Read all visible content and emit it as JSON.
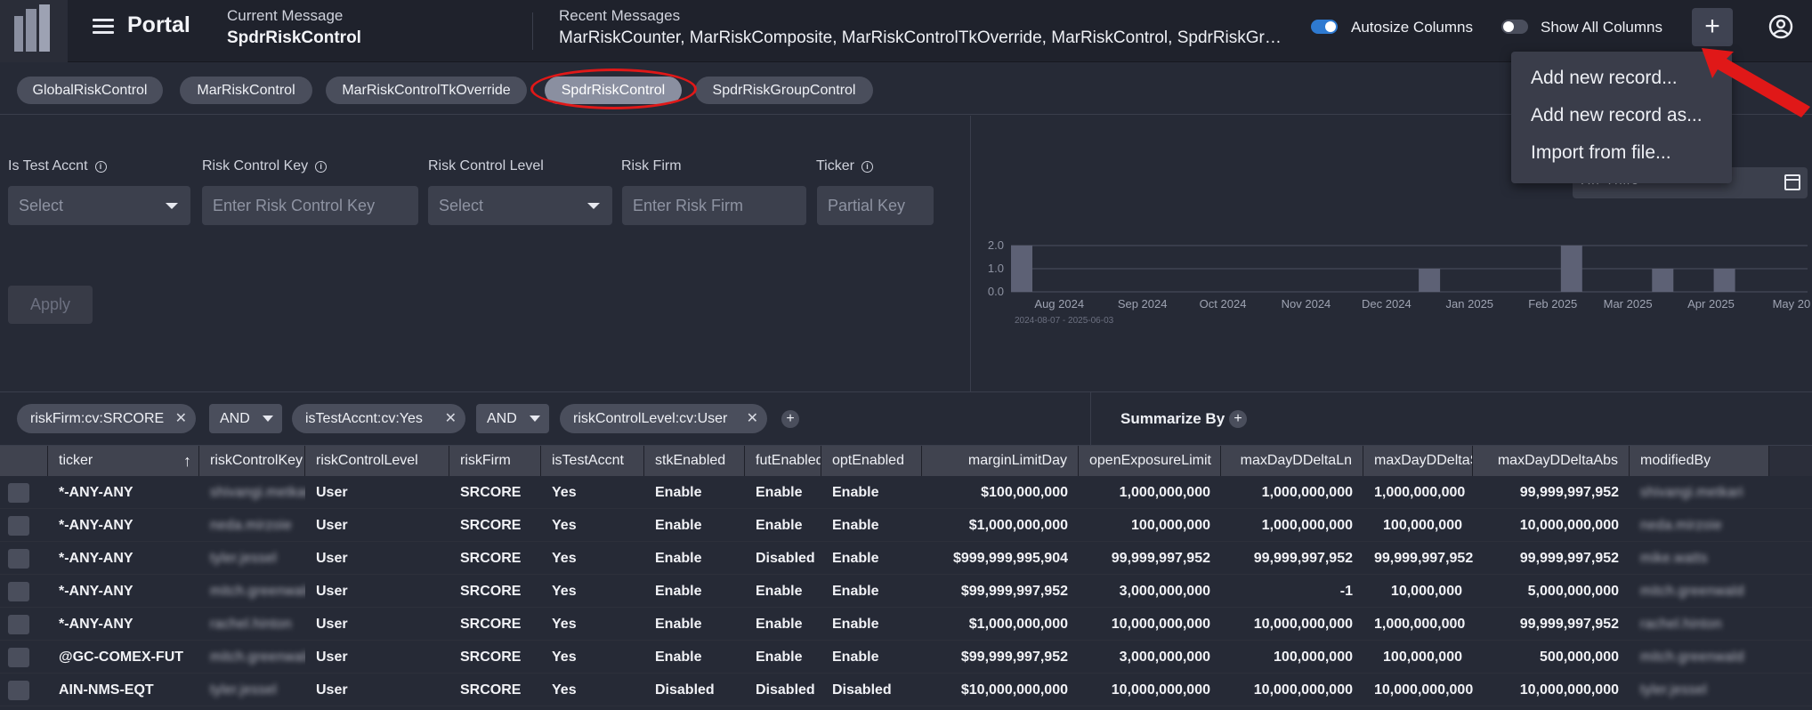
{
  "header": {
    "app_title": "Portal",
    "current_message_label": "Current Message",
    "current_message": "SpdrRiskControl",
    "recent_messages_label": "Recent Messages",
    "recent_messages": "MarRiskCounter, MarRiskComposite, MarRiskControlTkOverride, MarRiskControl, SpdrRiskGroupControl",
    "autosize_label": "Autosize Columns",
    "autosize_on": true,
    "show_all_label": "Show All Columns",
    "show_all_on": false,
    "add_button": "+",
    "toggle_on_color": "#2e7ad1"
  },
  "tabs": [
    "GlobalRiskControl",
    "MarRiskControl",
    "MarRiskControlTkOverride",
    "SpdrRiskControl",
    "SpdrRiskGroupControl"
  ],
  "active_tab": "SpdrRiskControl",
  "annotation_color": "#e01818",
  "add_menu": {
    "items": [
      "Add new record...",
      "Add new record as...",
      "Import from file..."
    ]
  },
  "filters": {
    "is_test_accnt": {
      "label": "Is Test Accnt",
      "placeholder": "Select"
    },
    "risk_control_key": {
      "label": "Risk Control Key",
      "placeholder": "Enter Risk Control Key"
    },
    "risk_control_level": {
      "label": "Risk Control Level",
      "placeholder": "Select"
    },
    "risk_firm": {
      "label": "Risk Firm",
      "placeholder": "Enter Risk Firm"
    },
    "ticker": {
      "label": "Ticker",
      "placeholder": "Partial Key"
    },
    "apply_label": "Apply"
  },
  "timeline": {
    "date_range_label": "All Time",
    "range_caption": "2024-08-07 - 2025-06-03",
    "y_ticks": [
      "2.0",
      "1.0",
      "0.0"
    ],
    "x_ticks": [
      "Aug 2024",
      "Sep 2024",
      "Oct 2024",
      "Nov 2024",
      "Dec 2024",
      "Jan 2025",
      "Feb 2025",
      "Mar 2025",
      "Apr 2025",
      "May 20"
    ]
  },
  "chart_data": {
    "type": "bar",
    "title": "",
    "xlabel": "",
    "ylabel": "",
    "ylim": [
      0,
      2
    ],
    "categories": [
      "2024-08-07",
      "2025-01-10",
      "2025-03-04",
      "2025-04-07",
      "2025-04-30"
    ],
    "values": [
      2,
      1,
      2,
      1,
      1
    ],
    "bar_color": "#5d6175"
  },
  "filter_chips": {
    "chips": [
      "riskFirm:cv:SRCORE",
      "isTestAccnt:cv:Yes",
      "riskControlLevel:cv:User"
    ],
    "operators": [
      "AND",
      "AND"
    ],
    "summarize_label": "Summarize By"
  },
  "grid": {
    "columns": [
      "ticker",
      "riskControlKey",
      "riskControlLevel",
      "riskFirm",
      "isTestAccnt",
      "stkEnabled",
      "futEnabled",
      "optEnabled",
      "marginLimitDay",
      "openExposureLimit",
      "maxDayDDeltaLn",
      "maxDayDDeltaSh",
      "maxDayDDeltaAbs",
      "modifiedBy"
    ],
    "rows": [
      [
        "*-ANY-ANY",
        "shivangi.metkari",
        "User",
        "SRCORE",
        "Yes",
        "Enable",
        "Enable",
        "Enable",
        "$100,000,000",
        "1,000,000,000",
        "1,000,000,000",
        "1,000,000,000",
        "99,999,997,952",
        "shivangi.metkari"
      ],
      [
        "*-ANY-ANY",
        "neda.mirzoie",
        "User",
        "SRCORE",
        "Yes",
        "Enable",
        "Enable",
        "Enable",
        "$1,000,000,000",
        "100,000,000",
        "1,000,000,000",
        "100,000,000",
        "10,000,000,000",
        "neda.mirzoie"
      ],
      [
        "*-ANY-ANY",
        "tyler.jessel",
        "User",
        "SRCORE",
        "Yes",
        "Enable",
        "Disabled",
        "Enable",
        "$999,999,995,904",
        "99,999,997,952",
        "99,999,997,952",
        "99,999,997,952",
        "99,999,997,952",
        "mike.watts"
      ],
      [
        "*-ANY-ANY",
        "mitch.greenwald",
        "User",
        "SRCORE",
        "Yes",
        "Enable",
        "Enable",
        "Enable",
        "$99,999,997,952",
        "3,000,000,000",
        "-1",
        "10,000,000",
        "5,000,000,000",
        "mitch.greenwald"
      ],
      [
        "*-ANY-ANY",
        "rachel.hinton",
        "User",
        "SRCORE",
        "Yes",
        "Enable",
        "Enable",
        "Enable",
        "$1,000,000,000",
        "10,000,000,000",
        "10,000,000,000",
        "1,000,000,000",
        "99,999,997,952",
        "rachel.hinton"
      ],
      [
        "@GC-COMEX-FUT",
        "mitch.greenwald",
        "User",
        "SRCORE",
        "Yes",
        "Enable",
        "Enable",
        "Enable",
        "$99,999,997,952",
        "3,000,000,000",
        "100,000,000",
        "100,000,000",
        "500,000,000",
        "mitch.greenwald"
      ],
      [
        "AIN-NMS-EQT",
        "tyler.jessel",
        "User",
        "SRCORE",
        "Yes",
        "Disabled",
        "Disabled",
        "Disabled",
        "$10,000,000,000",
        "10,000,000,000",
        "10,000,000,000",
        "10,000,000,000",
        "10,000,000,000",
        "tyler.jessel"
      ]
    ]
  }
}
